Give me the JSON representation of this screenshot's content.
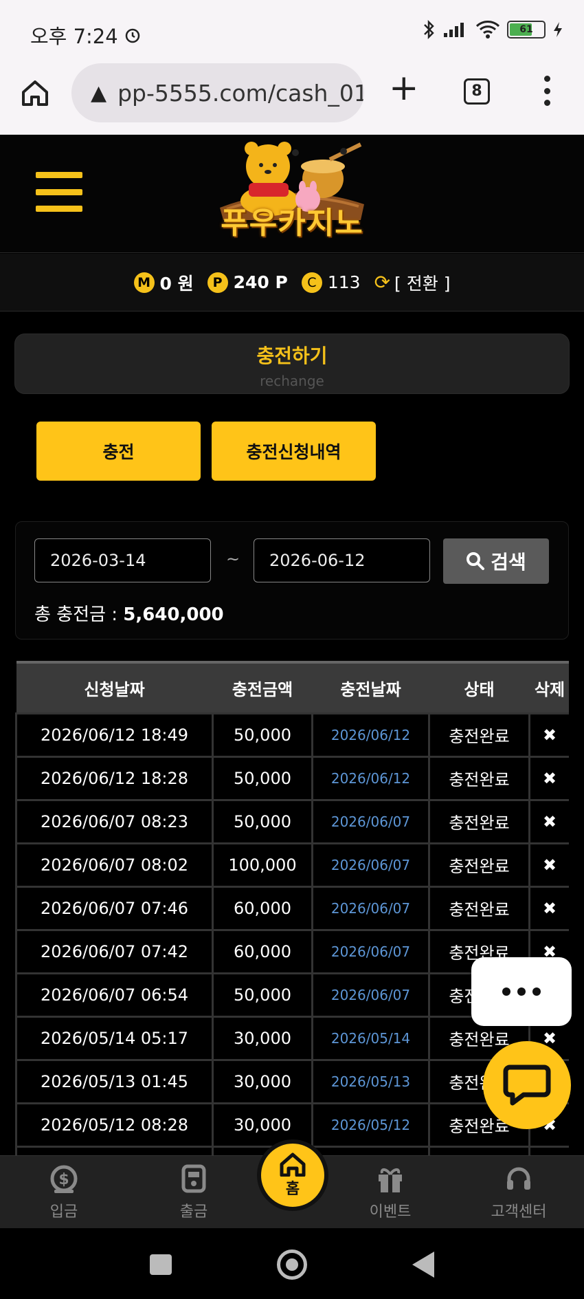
{
  "status_bar": {
    "time": "오후 7:24",
    "battery": "61"
  },
  "browser": {
    "url": "pp-5555.com/cash_01",
    "tab_count": "8"
  },
  "site": {
    "logo_text": "푸우카지노"
  },
  "balance": {
    "money": {
      "badge": "M",
      "value": "0 원"
    },
    "point": {
      "badge": "P",
      "value": "240 P"
    },
    "coin": {
      "badge": "C",
      "value": "113"
    },
    "convert_label": "[ 전환 ]"
  },
  "page_title": {
    "title": "충전하기",
    "subtitle": "rechange"
  },
  "tabs": {
    "charge": "충전",
    "history": "충전신청내역"
  },
  "search": {
    "date_from": "2026-03-14",
    "separator": "~",
    "date_to": "2026-06-12",
    "button": "검색",
    "total_label": "총 충전금 : ",
    "total_value": "5,640,000"
  },
  "table": {
    "headers": [
      "신청날짜",
      "충전금액",
      "충전날짜",
      "상태",
      "삭제"
    ],
    "rows": [
      [
        "2026/06/12 18:49",
        "50,000",
        "2026/06/12",
        "충전완료",
        "✖"
      ],
      [
        "2026/06/12 18:28",
        "50,000",
        "2026/06/12",
        "충전완료",
        "✖"
      ],
      [
        "2026/06/07 08:23",
        "50,000",
        "2026/06/07",
        "충전완료",
        "✖"
      ],
      [
        "2026/06/07 08:02",
        "100,000",
        "2026/06/07",
        "충전완료",
        "✖"
      ],
      [
        "2026/06/07 07:46",
        "60,000",
        "2026/06/07",
        "충전완료",
        "✖"
      ],
      [
        "2026/06/07 07:42",
        "60,000",
        "2026/06/07",
        "충전완료",
        "✖"
      ],
      [
        "2026/06/07 06:54",
        "50,000",
        "2026/06/07",
        "충전완료",
        "✖"
      ],
      [
        "2026/05/14 05:17",
        "30,000",
        "2026/05/14",
        "충전완료",
        "✖"
      ],
      [
        "2026/05/13 01:45",
        "30,000",
        "2026/05/13",
        "충전완료",
        "✖"
      ],
      [
        "2026/05/12 08:28",
        "30,000",
        "2026/05/12",
        "충전완료",
        "✖"
      ],
      [
        "",
        "",
        "",
        "",
        ""
      ]
    ]
  },
  "bottom_nav": {
    "deposit": "입금",
    "withdraw": "출금",
    "home": "홈",
    "event": "이벤트",
    "support": "고객센터"
  },
  "colors": {
    "accent": "#ffc418",
    "link_date": "#5d96d6",
    "background": "#000000"
  }
}
